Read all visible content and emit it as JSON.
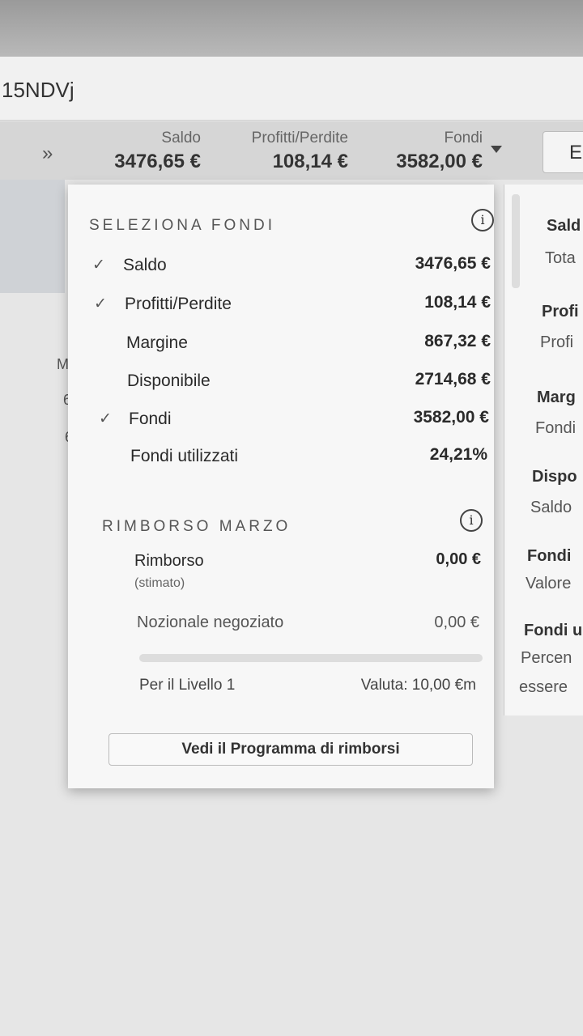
{
  "browser": {
    "url_fragment": "15NDVj"
  },
  "header": {
    "saldo_label": "Saldo",
    "saldo_value": "3476,65 €",
    "pl_label": "Profitti/Perdite",
    "pl_value": "108,14 €",
    "fondi_label": "Fondi",
    "fondi_value": "3582,00 €",
    "expand_glyph": "»",
    "right_button": "E"
  },
  "popup": {
    "funds_title": "SELEZIONA FONDI",
    "funds": [
      {
        "label": "Saldo",
        "value": "3476,65 €",
        "checked": "✓"
      },
      {
        "label": "Profitti/Perdite",
        "value": "108,14 €",
        "checked": "✓"
      },
      {
        "label": "Margine",
        "value": "867,32 €",
        "checked": ""
      },
      {
        "label": "Disponibile",
        "value": "2714,68 €",
        "checked": ""
      },
      {
        "label": "Fondi",
        "value": "3582,00 €",
        "checked": "✓"
      },
      {
        "label": "Fondi utilizzati",
        "value": "24,21%",
        "checked": ""
      }
    ],
    "rebate_title": "RIMBORSO MARZO",
    "rebate_label": "Rimborso",
    "rebate_sub": "(stimato)",
    "rebate_value": "0,00 €",
    "notional_label": "Nozionale negoziato",
    "notional_value": "0,00 €",
    "progress_fraction": 0,
    "level_label": "Per il Livello 1",
    "currency_label": "Valuta: 10,00 €m",
    "button_label": "Vedi il Programma di rimborsi",
    "info_glyph": "i"
  },
  "left_column": [
    "M",
    "6",
    "6"
  ],
  "right_panel": {
    "items": [
      "Sald",
      "Tota",
      "Profi",
      "Profi",
      "Marg",
      "Fondi",
      "Dispo",
      "Saldo",
      "Fondi",
      "Valore",
      "Fondi u",
      "Percen",
      "essere"
    ]
  }
}
